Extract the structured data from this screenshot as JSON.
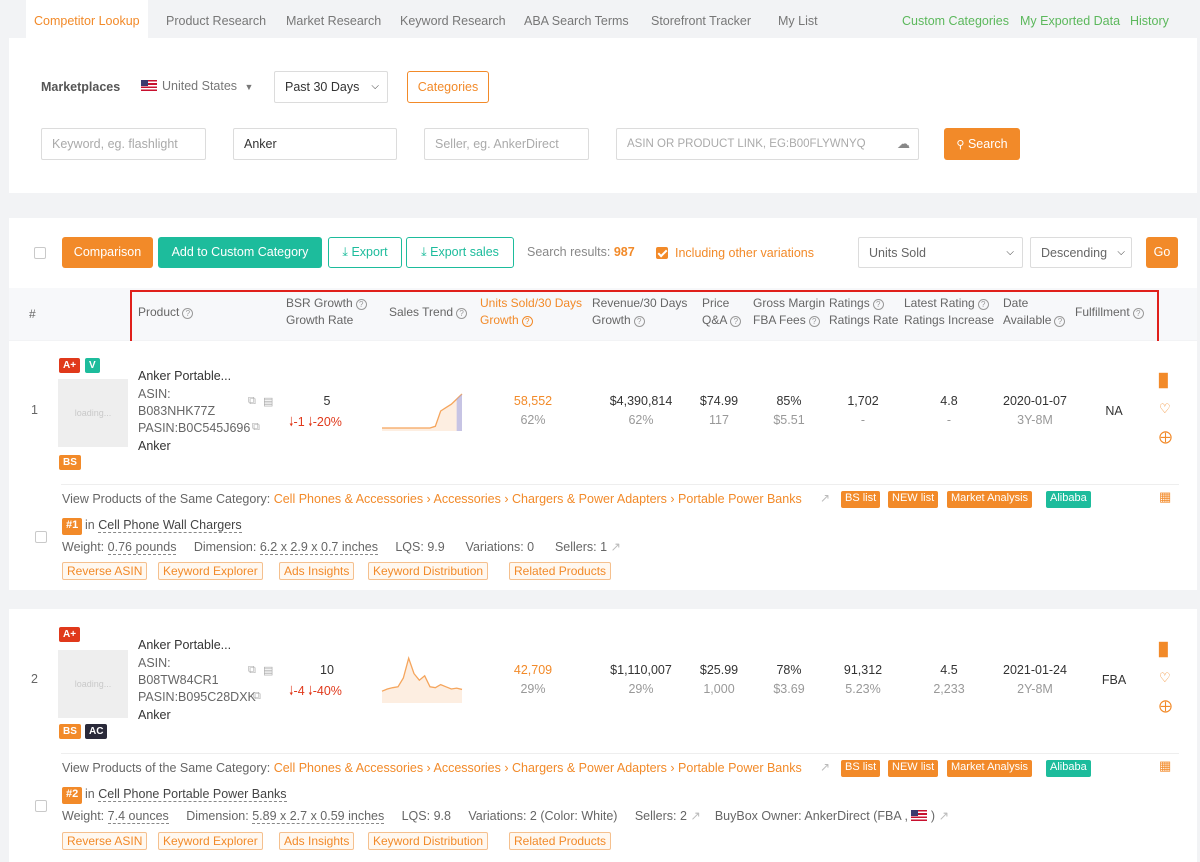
{
  "nav": {
    "tabs": [
      "Competitor Lookup",
      "Product Research",
      "Market Research",
      "Keyword Research",
      "ABA Search Terms",
      "Storefront Tracker",
      "My List"
    ],
    "right_links": [
      "Custom Categories",
      "My Exported Data",
      "History"
    ]
  },
  "filters": {
    "marketplaces_label": "Marketplaces",
    "country": "United States",
    "period": "Past 30 Days",
    "categories_button": "Categories",
    "keyword_placeholder": "Keyword, eg. flashlight",
    "brand_value": "Anker",
    "seller_placeholder": "Seller, eg. AnkerDirect",
    "asin_placeholder": "ASIN OR PRODUCT LINK, EG:B00FLYWNYQ",
    "search_button": "Search"
  },
  "toolbar": {
    "comparison": "Comparison",
    "add_custom": "Add to Custom Category",
    "export": "Export",
    "export_sales": "Export sales",
    "results_label": "Search results:",
    "results_count": "987",
    "include_variations": "Including other variations",
    "sort_field": "Units Sold",
    "sort_order": "Descending",
    "go": "Go"
  },
  "columns": {
    "index": "#",
    "product": "Product",
    "bsr_1": "BSR Growth",
    "bsr_2": "Growth Rate",
    "trend": "Sales Trend",
    "units_1": "Units Sold/30 Days",
    "units_2": "Growth",
    "rev_1": "Revenue/30 Days",
    "rev_2": "Growth",
    "price_1": "Price",
    "price_2": "Q&A",
    "margin_1": "Gross Margin",
    "margin_2": "FBA Fees",
    "ratings_1": "Ratings",
    "ratings_2": "Ratings Rate",
    "latest_1": "Latest Rating",
    "latest_2": "Ratings Increase",
    "date_1": "Date",
    "date_2": "Available",
    "fulfillment": "Fulfillment"
  },
  "rows": [
    {
      "index": "1",
      "badges": [
        "A+",
        "V"
      ],
      "bottom_badges": [
        "BS"
      ],
      "loading": "loading...",
      "title": "Anker Portable...",
      "asin_label": "ASIN:",
      "asin": "B083NHK77Z",
      "pasin": "PASIN:B0C545J696",
      "brand": "Anker",
      "bsr": "5",
      "bsr_change": "-1",
      "bsr_rate": "-20%",
      "units": "58,552",
      "units_growth": "62%",
      "revenue": "$4,390,814",
      "revenue_growth": "62%",
      "price": "$74.99",
      "qa": "117",
      "margin": "85%",
      "fba": "$5.51",
      "ratings": "1,702",
      "ratings_rate": "-",
      "latest_rating": "4.8",
      "ratings_increase": "-",
      "date": "2020-01-07",
      "age": "3Y-8M",
      "fulfillment": "NA",
      "trend": [
        0,
        0,
        0,
        0,
        0,
        0,
        0,
        0,
        0,
        0,
        0.05,
        0.5,
        0.6,
        0.7,
        0.85,
        1.0
      ],
      "category_label": "View Products of the Same Category:",
      "category_path": "Cell Phones & Accessories › Accessories › Chargers & Power Adapters › Portable Power Banks",
      "cat_tags": [
        "BS list",
        "NEW list",
        "Market Analysis",
        "Alibaba"
      ],
      "rank": "#1",
      "rank_in": "in",
      "rank_category": "Cell Phone Wall Chargers",
      "weight_label": "Weight:",
      "weight": "0.76 pounds",
      "dim_label": "Dimension:",
      "dim": "6.2 x 2.9 x 0.7 inches",
      "lqs": "LQS: 9.9",
      "variations": "Variations: 0",
      "sellers": "Sellers: 1",
      "buybox": "",
      "tools": [
        "Reverse ASIN",
        "Keyword Explorer",
        "Ads Insights",
        "Keyword Distribution",
        "Related Products"
      ]
    },
    {
      "index": "2",
      "badges": [
        "A+"
      ],
      "bottom_badges": [
        "BS",
        "AC"
      ],
      "loading": "loading...",
      "title": "Anker Portable...",
      "asin_label": "ASIN:",
      "asin": "B08TW84CR1",
      "pasin": "PASIN:B095C28DXK",
      "brand": "Anker",
      "bsr": "10",
      "bsr_change": "-4",
      "bsr_rate": "-40%",
      "units": "42,709",
      "units_growth": "29%",
      "revenue": "$1,110,007",
      "revenue_growth": "29%",
      "price": "$25.99",
      "qa": "1,000",
      "margin": "78%",
      "fba": "$3.69",
      "ratings": "91,312",
      "ratings_rate": "5.23%",
      "latest_rating": "4.5",
      "ratings_increase": "2,233",
      "date": "2021-01-24",
      "age": "2Y-8M",
      "fulfillment": "FBA",
      "trend": [
        0.2,
        0.25,
        0.28,
        0.3,
        0.5,
        0.95,
        0.6,
        0.45,
        0.55,
        0.3,
        0.28,
        0.35,
        0.3,
        0.25,
        0.27,
        0.24
      ],
      "category_label": "View Products of the Same Category:",
      "category_path": "Cell Phones & Accessories › Accessories › Chargers & Power Adapters › Portable Power Banks",
      "cat_tags": [
        "BS list",
        "NEW list",
        "Market Analysis",
        "Alibaba"
      ],
      "rank": "#2",
      "rank_in": "in",
      "rank_category": "Cell Phone Portable Power Banks",
      "weight_label": "Weight:",
      "weight": "7.4 ounces",
      "dim_label": "Dimension:",
      "dim": "5.89 x 2.7 x 0.59 inches",
      "lqs": "LQS: 9.8",
      "variations": "Variations: 2 (Color: White)",
      "sellers": "Sellers: 2",
      "buybox": "BuyBox Owner:  AnkerDirect  (FBA ,",
      "buybox_end": ")",
      "tools": [
        "Reverse ASIN",
        "Keyword Explorer",
        "Ads Insights",
        "Keyword Distribution",
        "Related Products"
      ]
    }
  ],
  "colors": {
    "accent": "#f28a29",
    "teal": "#1dbc9c",
    "red": "#e0391b",
    "link_green": "#5cb85c"
  }
}
